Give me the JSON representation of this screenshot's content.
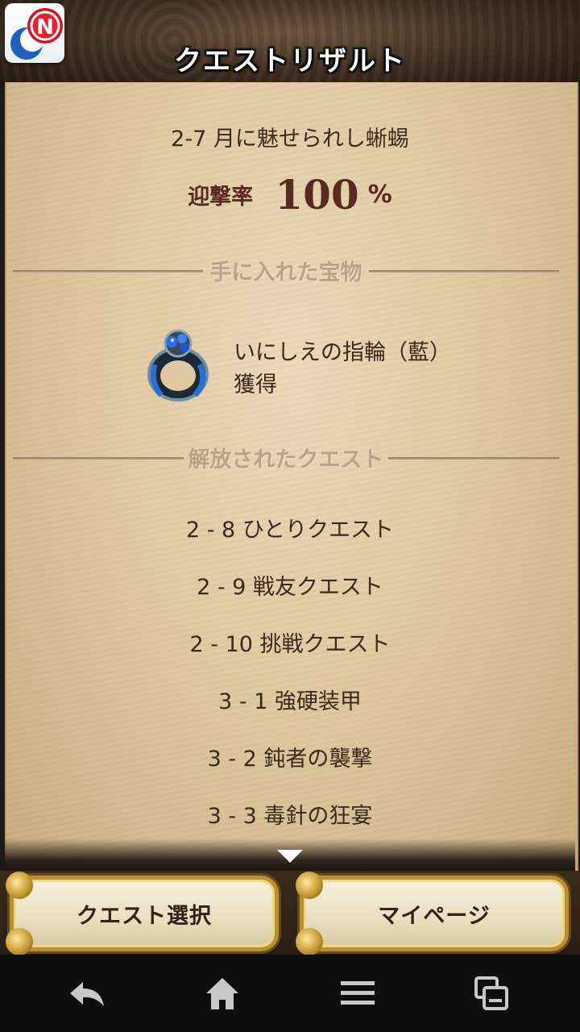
{
  "header": {
    "title": "クエストリザルト",
    "app_icon_letter": "N"
  },
  "result": {
    "quest_name": "2-7 月に魅せられし蜥蜴",
    "rate_label": "迎撃率",
    "rate_value": "100",
    "rate_unit": "%"
  },
  "treasure_section": {
    "heading": "手に入れた宝物",
    "item_name": "いにしえの指輪（藍）",
    "status": "獲得",
    "icon": "ring-icon"
  },
  "unlocked_section": {
    "heading": "解放されたクエスト",
    "quests": [
      "2 - 8 ひとりクエスト",
      "2 - 9 戦友クエスト",
      "2 - 10 挑戦クエスト",
      "3 - 1 強硬装甲",
      "3 - 2 鈍者の襲撃",
      "3 - 3 毒針の狂宴"
    ]
  },
  "buttons": {
    "quest_select": "クエスト選択",
    "my_page": "マイページ"
  },
  "navbar": {
    "icons": [
      "back-icon",
      "home-icon",
      "menu-icon",
      "recent-apps-icon"
    ]
  },
  "colors": {
    "parchment": "#e0c9a2",
    "text": "#3a2a1a",
    "rate_text": "#5a2a22",
    "gold": "#b8903a"
  }
}
